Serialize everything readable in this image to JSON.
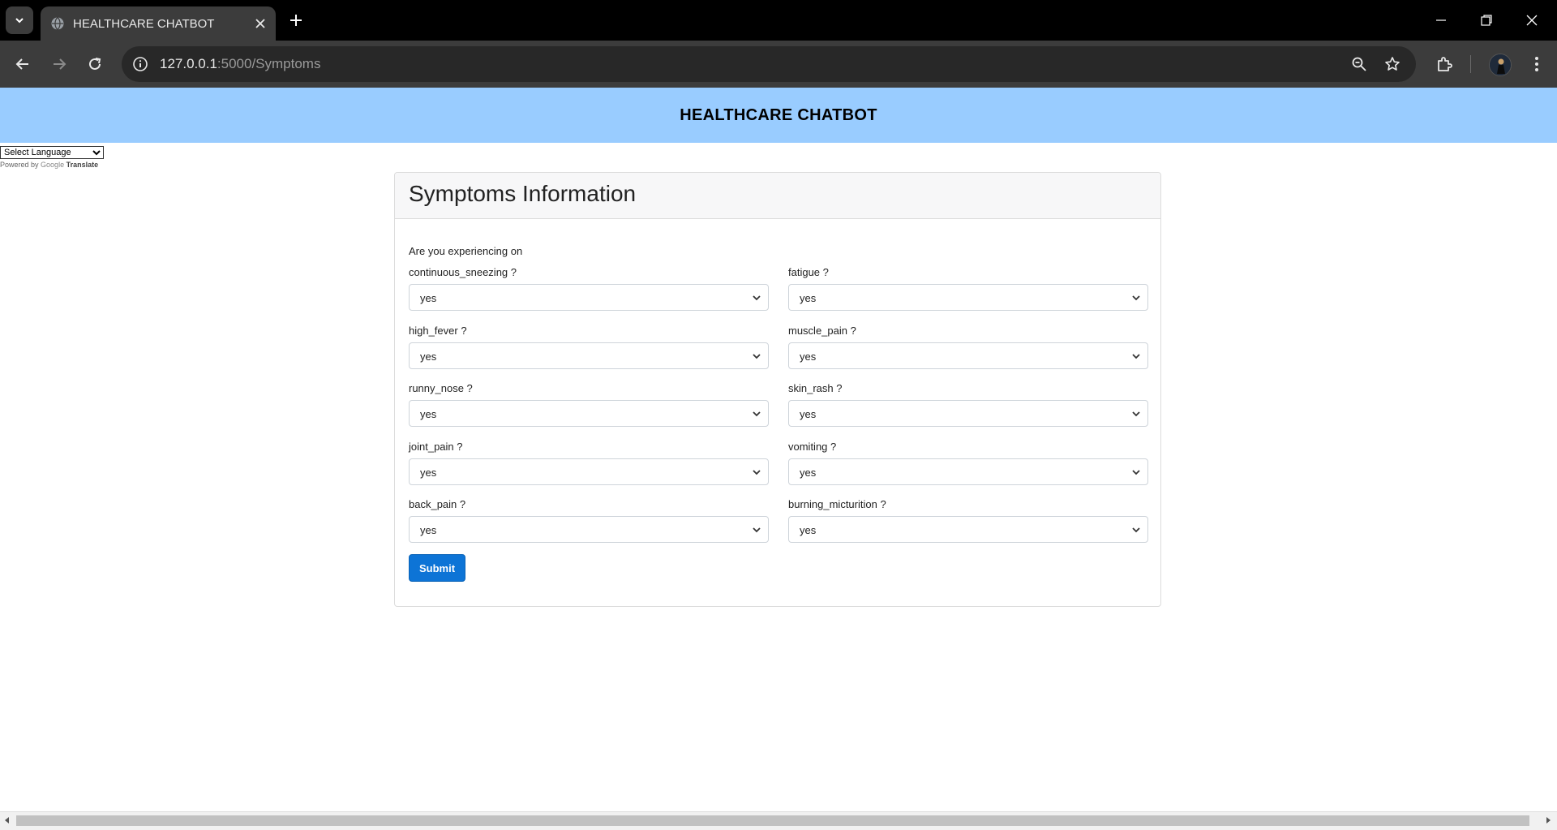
{
  "browser": {
    "tab_title": "HEALTHCARE CHATBOT",
    "url_host": "127.0.0.1",
    "url_path": ":5000/Symptoms"
  },
  "header": {
    "title": "HEALTHCARE CHATBOT",
    "background": "#99ccff"
  },
  "translate": {
    "select_label": "Select Language",
    "powered_by": "Powered by",
    "google": "Google",
    "translate": "Translate"
  },
  "form": {
    "title": "Symptoms Information",
    "intro": "Are you experiencing on",
    "fields": [
      {
        "label": "continuous_sneezing ?",
        "value": "yes"
      },
      {
        "label": "fatigue ?",
        "value": "yes"
      },
      {
        "label": "high_fever ?",
        "value": "yes"
      },
      {
        "label": "muscle_pain ?",
        "value": "yes"
      },
      {
        "label": "runny_nose ?",
        "value": "yes"
      },
      {
        "label": "skin_rash ?",
        "value": "yes"
      },
      {
        "label": "joint_pain ?",
        "value": "yes"
      },
      {
        "label": "vomiting ?",
        "value": "yes"
      },
      {
        "label": "back_pain ?",
        "value": "yes"
      },
      {
        "label": "burning_micturition ?",
        "value": "yes"
      }
    ],
    "submit_label": "Submit",
    "submit_color": "#0d74d6"
  },
  "icons": {
    "tab_list": "chevron-down-icon",
    "favicon": "globe-icon",
    "tab_close": "close-icon",
    "new_tab": "plus-icon",
    "back": "back-arrow-icon",
    "forward": "forward-arrow-icon",
    "reload": "reload-icon",
    "site_info": "info-icon",
    "zoom": "zoom-icon",
    "bookmark": "star-icon",
    "extensions": "puzzle-icon",
    "menu": "kebab-menu-icon"
  }
}
